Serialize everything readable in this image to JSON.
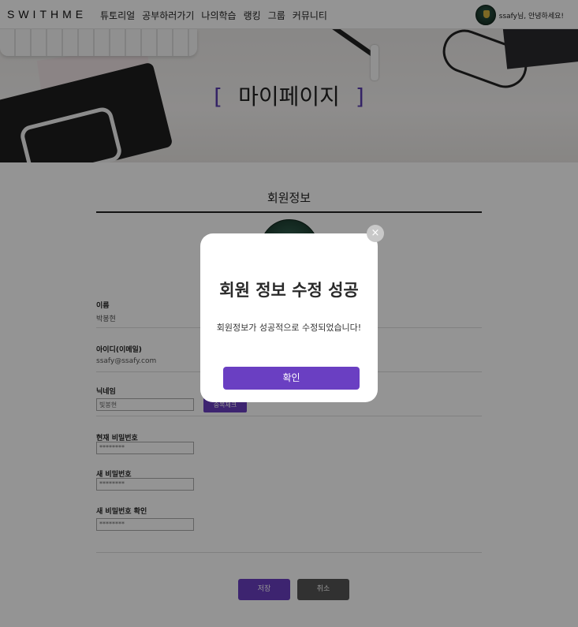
{
  "nav": {
    "logo": "SWITHME",
    "menu": [
      "튜토리얼",
      "공부하러가기",
      "나의학습",
      "랭킹",
      "그룹",
      "커뮤니티"
    ],
    "greeting": "ssafy님, 안녕하세요!"
  },
  "hero": {
    "title": "마이페이지",
    "bracket_left": "[",
    "bracket_right": "]"
  },
  "profile": {
    "section_title": "회원정보",
    "name_label": "이름",
    "name_value": "박봉현",
    "id_label": "아이디(이메일)",
    "id_value": "ssafy@ssafy.com",
    "nickname_label": "닉네임",
    "nickname_value": "빛봉현",
    "dup_check": "중복체크",
    "current_pw_label": "현재 비밀번호",
    "current_pw_placeholder": "********",
    "new_pw_label": "새 비밀번호",
    "new_pw_placeholder": "********",
    "confirm_pw_label": "새 비밀번호 확인",
    "confirm_pw_placeholder": "********",
    "save": "저장",
    "cancel": "취소"
  },
  "modal": {
    "title": "회원 정보 수정 성공",
    "message": "회원정보가 성공적으로 수정되었습니다!",
    "ok": "확인",
    "close": "×"
  },
  "colors": {
    "accent": "#6a3fc2",
    "overlay": "rgba(0,0,0,0.42)"
  }
}
